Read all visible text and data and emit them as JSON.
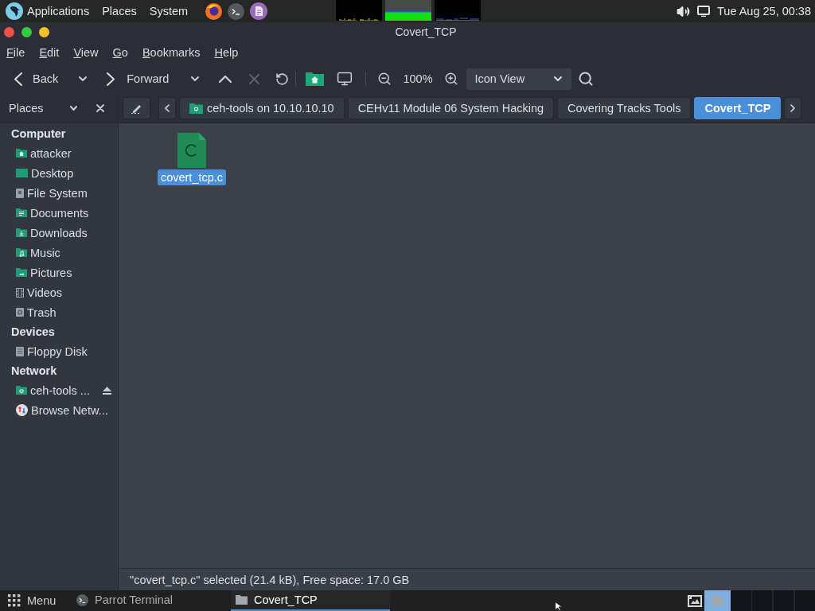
{
  "top_panel": {
    "menus": [
      "Applications",
      "Places",
      "System"
    ],
    "clock": "Tue Aug 25, 00:38"
  },
  "window": {
    "title": "Covert_TCP"
  },
  "menu_bar": [
    "File",
    "Edit",
    "View",
    "Go",
    "Bookmarks",
    "Help"
  ],
  "toolbar": {
    "back": "Back",
    "forward": "Forward",
    "stop": {
      "disabled": true
    },
    "zoom": "100%",
    "view_mode": "Icon View"
  },
  "location_bar": {
    "sidebar_title": "Places",
    "crumbs": [
      {
        "label": "ceh-tools on 10.10.10.10",
        "kind": "share",
        "selected": false
      },
      {
        "label": "CEHv11 Module 06 System Hacking",
        "kind": "folder",
        "selected": false
      },
      {
        "label": "Covering Tracks Tools",
        "kind": "folder",
        "selected": false
      },
      {
        "label": "Covert_TCP",
        "kind": "folder",
        "selected": true
      }
    ]
  },
  "sidebar": {
    "sections": [
      {
        "title": "Computer",
        "items": [
          {
            "label": "attacker",
            "kind": "home",
            "selected": false
          },
          {
            "label": "Desktop",
            "kind": "desktop",
            "selected": false
          },
          {
            "label": "File System",
            "kind": "drive",
            "selected": false
          },
          {
            "label": "Documents",
            "kind": "documents",
            "selected": false
          },
          {
            "label": "Downloads",
            "kind": "downloads",
            "selected": false
          },
          {
            "label": "Music",
            "kind": "music",
            "selected": false
          },
          {
            "label": "Pictures",
            "kind": "pictures",
            "selected": false
          },
          {
            "label": "Videos",
            "kind": "videos",
            "selected": false
          },
          {
            "label": "Trash",
            "kind": "trash",
            "selected": false
          }
        ]
      },
      {
        "title": "Devices",
        "items": [
          {
            "label": "Floppy Disk",
            "kind": "floppy",
            "selected": false
          }
        ]
      },
      {
        "title": "Network",
        "items": [
          {
            "label": "ceh-tools ...",
            "kind": "mount",
            "selected": false
          },
          {
            "label": "Browse Netw...",
            "kind": "network",
            "selected": false
          }
        ]
      }
    ]
  },
  "files": [
    {
      "name": "covert_tcp.c",
      "kind": "c-source",
      "selected": true
    }
  ],
  "status_bar": "\"covert_tcp.c\" selected (21.4 kB), Free space: 17.0 GB",
  "taskbar": {
    "menu": "Menu",
    "windows": [
      {
        "label": "Parrot Terminal",
        "kind": "terminal",
        "selected": false
      },
      {
        "label": "Covert_TCP",
        "kind": "folder",
        "selected": true
      }
    ],
    "tray": [
      {
        "kind": "image",
        "selected": false
      },
      {
        "kind": "folder",
        "selected": true
      }
    ]
  }
}
